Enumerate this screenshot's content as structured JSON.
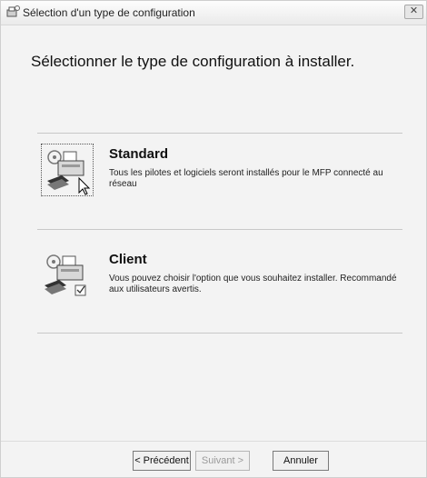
{
  "window": {
    "title": "Sélection d'un type de configuration",
    "close_label": "✕"
  },
  "main": {
    "heading": "Sélectionner le type de configuration à installer.",
    "options": [
      {
        "title": "Standard",
        "description": "Tous les pilotes et logiciels seront installés pour le MFP connecté au réseau",
        "icon": "printer-standard-icon",
        "selected": true
      },
      {
        "title": "Client",
        "description": "Vous pouvez choisir l'option que vous souhaitez installer. Recommandé aux utilisateurs avertis.",
        "icon": "printer-client-icon",
        "selected": false
      }
    ]
  },
  "buttons": {
    "back": "< Précédent",
    "next": "Suivant >",
    "cancel": "Annuler"
  },
  "colors": {
    "background": "#f3f3f3",
    "text": "#111111",
    "divider": "#c8c8c8"
  }
}
